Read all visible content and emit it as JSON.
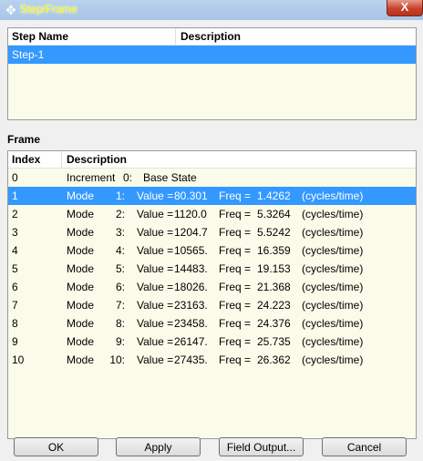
{
  "window": {
    "title": "Step/Frame",
    "icon": "move-cross-icon",
    "close_label": "X"
  },
  "step_table": {
    "columns": [
      "Step Name",
      "Description"
    ],
    "rows": [
      {
        "name": "Step-1",
        "description": ""
      }
    ]
  },
  "frame_section": {
    "label": "Frame",
    "columns": [
      "Index",
      "Description"
    ],
    "rows": [
      {
        "index": "0",
        "type": "Increment",
        "num": "0:",
        "label": "Base State",
        "value": "",
        "freq_label": "",
        "freq": "",
        "unit": ""
      },
      {
        "index": "1",
        "type": "Mode",
        "num": "1:",
        "label": "Value =",
        "value": "80.301",
        "freq_label": "Freq =",
        "freq": "1.4262",
        "unit": "(cycles/time)"
      },
      {
        "index": "2",
        "type": "Mode",
        "num": "2:",
        "label": "Value =",
        "value": "1120.0",
        "freq_label": "Freq =",
        "freq": "5.3264",
        "unit": "(cycles/time)"
      },
      {
        "index": "3",
        "type": "Mode",
        "num": "3:",
        "label": "Value =",
        "value": "1204.7",
        "freq_label": "Freq =",
        "freq": "5.5242",
        "unit": "(cycles/time)"
      },
      {
        "index": "4",
        "type": "Mode",
        "num": "4:",
        "label": "Value =",
        "value": "10565.",
        "freq_label": "Freq =",
        "freq": "16.359",
        "unit": "(cycles/time)"
      },
      {
        "index": "5",
        "type": "Mode",
        "num": "5:",
        "label": "Value =",
        "value": "14483.",
        "freq_label": "Freq =",
        "freq": "19.153",
        "unit": "(cycles/time)"
      },
      {
        "index": "6",
        "type": "Mode",
        "num": "6:",
        "label": "Value =",
        "value": "18026.",
        "freq_label": "Freq =",
        "freq": "21.368",
        "unit": "(cycles/time)"
      },
      {
        "index": "7",
        "type": "Mode",
        "num": "7:",
        "label": "Value =",
        "value": "23163.",
        "freq_label": "Freq =",
        "freq": "24.223",
        "unit": "(cycles/time)"
      },
      {
        "index": "8",
        "type": "Mode",
        "num": "8:",
        "label": "Value =",
        "value": "23458.",
        "freq_label": "Freq =",
        "freq": "24.376",
        "unit": "(cycles/time)"
      },
      {
        "index": "9",
        "type": "Mode",
        "num": "9:",
        "label": "Value =",
        "value": "26147.",
        "freq_label": "Freq =",
        "freq": "25.735",
        "unit": "(cycles/time)"
      },
      {
        "index": "10",
        "type": "Mode",
        "num": "10:",
        "label": "Value =",
        "value": "27435.",
        "freq_label": "Freq =",
        "freq": "26.362",
        "unit": "(cycles/time)"
      }
    ]
  },
  "buttons": {
    "ok": "OK",
    "apply": "Apply",
    "field_output": "Field Output...",
    "cancel": "Cancel"
  },
  "colors": {
    "selection": "#3399ff",
    "panel_background": "#fbfbea",
    "title_text": "#ffff00"
  }
}
